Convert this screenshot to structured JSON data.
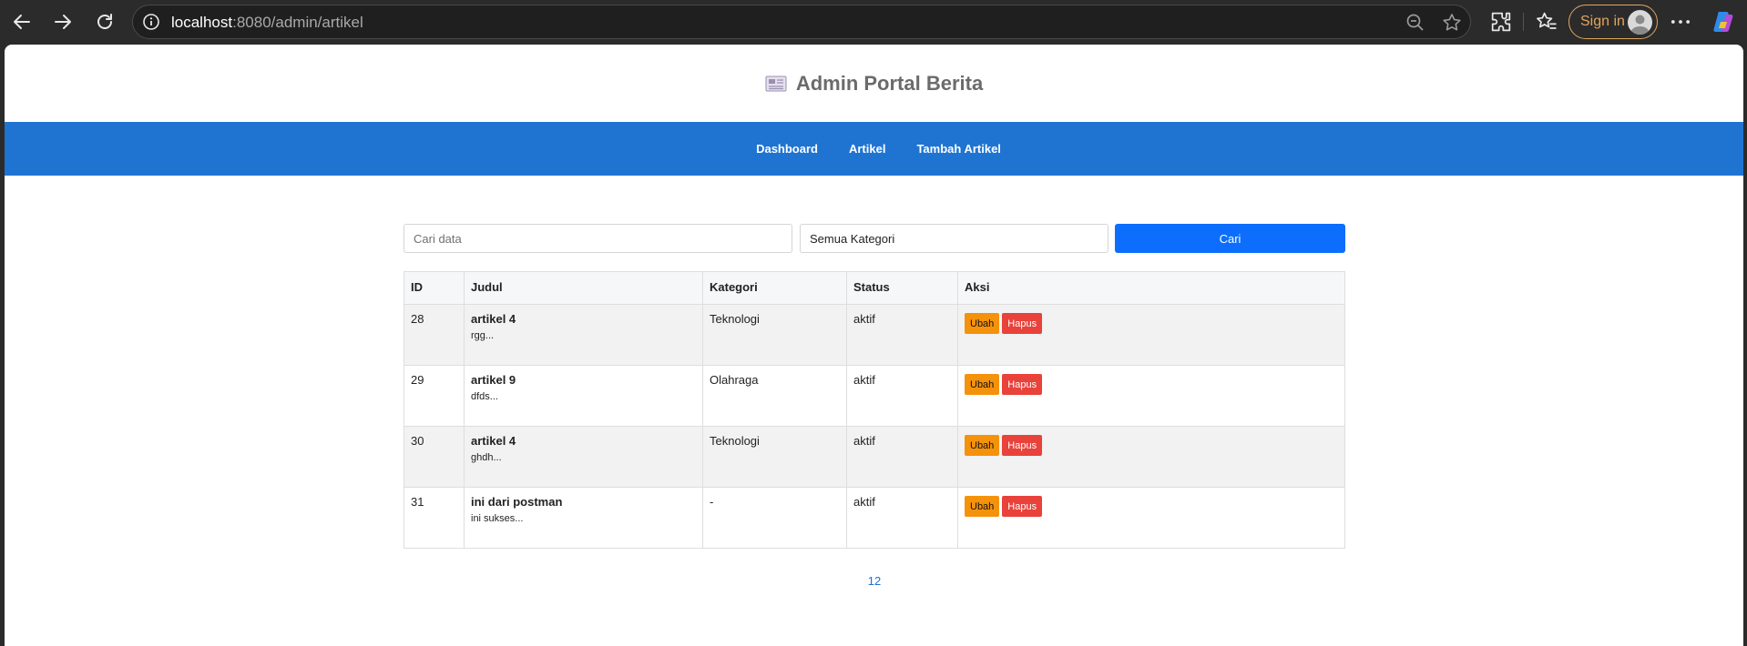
{
  "browser": {
    "url_host": "localhost",
    "url_rest": ":8080/admin/artikel",
    "sign_in_label": "Sign in"
  },
  "site": {
    "title": "Admin Portal Berita",
    "nav": [
      {
        "label": "Dashboard"
      },
      {
        "label": "Artikel"
      },
      {
        "label": "Tambah Artikel"
      }
    ]
  },
  "search": {
    "placeholder": "Cari data",
    "category_selected": "Semua Kategori",
    "button_label": "Cari"
  },
  "table": {
    "headers": [
      "ID",
      "Judul",
      "Kategori",
      "Status",
      "Aksi"
    ],
    "rows": [
      {
        "id": "28",
        "title": "artikel 4",
        "excerpt": "rgg...",
        "category": "Teknologi",
        "status": "aktif"
      },
      {
        "id": "29",
        "title": "artikel 9",
        "excerpt": "dfds...",
        "category": "Olahraga",
        "status": "aktif"
      },
      {
        "id": "30",
        "title": "artikel 4",
        "excerpt": "ghdh...",
        "category": "Teknologi",
        "status": "aktif"
      },
      {
        "id": "31",
        "title": "ini dari postman",
        "excerpt": "ini sukses...",
        "category": "-",
        "status": "aktif"
      }
    ],
    "edit_label": "Ubah",
    "delete_label": "Hapus"
  },
  "pagination": {
    "pages": "12"
  },
  "colors": {
    "nav_bg": "#1f74d2",
    "primary_button": "#0d6efd",
    "edit_button": "#f5920b",
    "delete_button": "#e8423b"
  }
}
